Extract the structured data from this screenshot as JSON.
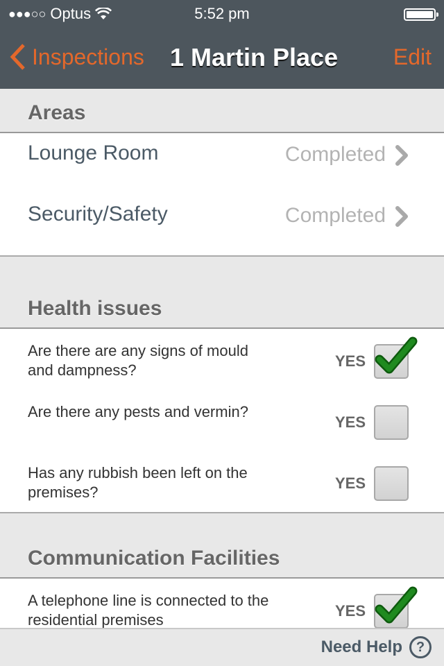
{
  "status_bar": {
    "signal": "●●●○○",
    "carrier": "Optus",
    "time": "5:52 pm",
    "battery_level": 1.0
  },
  "nav": {
    "back_label": "Inspections",
    "title": "1 Martin Place",
    "edit_label": "Edit"
  },
  "areas": {
    "header": "Areas",
    "items": [
      {
        "label": "Lounge Room",
        "status": "Completed"
      },
      {
        "label": "Security/Safety",
        "status": "Completed"
      }
    ]
  },
  "health": {
    "header": "Health issues",
    "items": [
      {
        "question": "Are there are any signs of mould and dampness?",
        "answer_label": "YES",
        "checked": true
      },
      {
        "question": "Are there any pests and vermin?",
        "answer_label": "YES",
        "checked": false
      },
      {
        "question": "Has any rubbish been left on the premises?",
        "answer_label": "YES",
        "checked": false
      }
    ]
  },
  "communication": {
    "header": "Communication Facilities",
    "items": [
      {
        "question": "A telephone line is connected to the residential premises",
        "answer_label": "YES",
        "checked": true
      }
    ]
  },
  "footer": {
    "help_label": "Need Help",
    "help_icon": "?"
  },
  "colors": {
    "accent": "#e4682b",
    "navbar": "#4d565d",
    "check": "#1f8a1f"
  }
}
